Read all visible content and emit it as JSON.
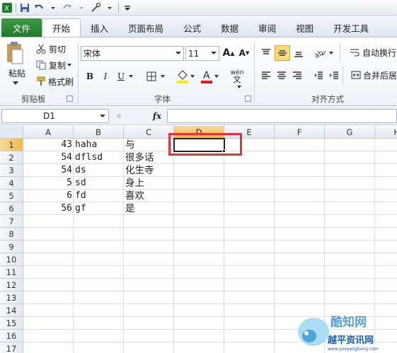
{
  "ribbon_tabs": [
    {
      "label": "文件"
    },
    {
      "label": "开始"
    },
    {
      "label": "插入"
    },
    {
      "label": "页面布局"
    },
    {
      "label": "公式"
    },
    {
      "label": "数据"
    },
    {
      "label": "审阅"
    },
    {
      "label": "视图"
    },
    {
      "label": "开发工具"
    }
  ],
  "clipboard": {
    "paste": "粘贴",
    "cut": "剪切",
    "copy": "复制",
    "format_painter": "格式刷",
    "group": "剪贴板"
  },
  "font": {
    "name": "宋体",
    "size": "11",
    "bold": "B",
    "italic": "I",
    "underline": "U",
    "group": "字体",
    "phonetic": "wén"
  },
  "alignment": {
    "wrap_text": "自动换行",
    "merge_center": "合并后居",
    "group": "对齐方式"
  },
  "formula_bar": {
    "name_box": "D1",
    "fx": "fx",
    "value": ""
  },
  "columns": [
    "A",
    "B",
    "C",
    "D",
    "E",
    "F",
    "G",
    "H"
  ],
  "rows": [
    "1",
    "2",
    "3",
    "4",
    "5",
    "6",
    "7",
    "8",
    "9",
    "10",
    "11",
    "12",
    "13",
    "14",
    "15",
    "16",
    "17"
  ],
  "cells": [
    {
      "a": "43",
      "b": "haha",
      "c": "与"
    },
    {
      "a": "54",
      "b": "dflsd",
      "c": "很多话"
    },
    {
      "a": "54",
      "b": "ds",
      "c": "化生寺"
    },
    {
      "a": "5",
      "b": "sd",
      "c": "身上"
    },
    {
      "a": "6",
      "b": "fd",
      "c": "喜欢"
    },
    {
      "a": "56",
      "b": "gf",
      "c": "是"
    }
  ],
  "selected_cell": "D1",
  "watermark": {
    "line1": "酷知网",
    "line2": "越平资讯网",
    "url": "www.yueyangbang.com"
  },
  "colors": {
    "file_tab": "#2a8a35",
    "selection": "#222222",
    "highlight_box": "#e0343a",
    "header_selected": "#f0b94d"
  }
}
